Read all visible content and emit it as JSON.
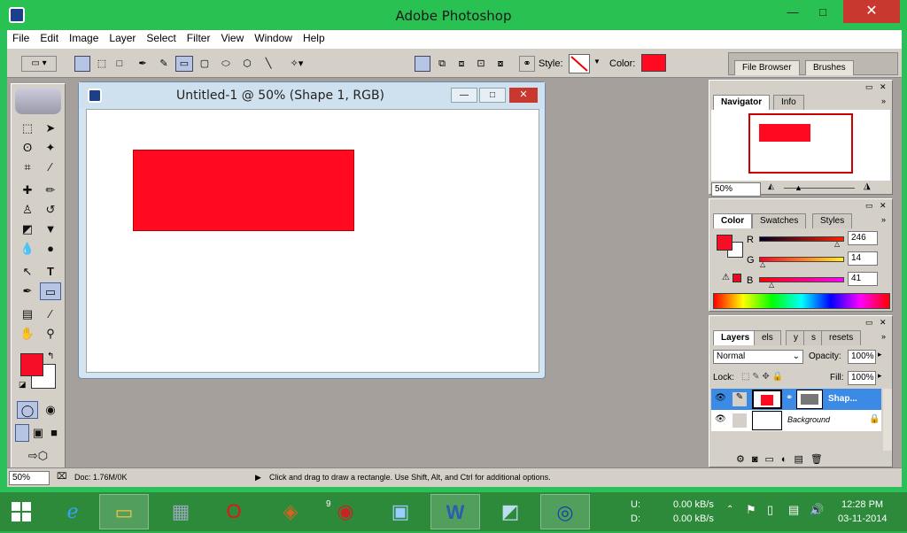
{
  "app_title": "Adobe Photoshop",
  "window_controls": {
    "minimize": "—",
    "maximize": "□",
    "close": "✕"
  },
  "menu": [
    "File",
    "Edit",
    "Image",
    "Layer",
    "Select",
    "Filter",
    "View",
    "Window",
    "Help"
  ],
  "options": {
    "style_label": "Style:",
    "color_label": "Color:",
    "color": "#ff0a20",
    "file_browser": "File Browser",
    "brushes": "Brushes"
  },
  "document": {
    "title": "Untitled-1 @ 50% (Shape 1, RGB)"
  },
  "navigator": {
    "tabs": [
      "Navigator",
      "Info"
    ],
    "zoom": "50%"
  },
  "color_panel": {
    "tabs": [
      "Color",
      "Swatches",
      "Styles"
    ],
    "channels": [
      {
        "label": "R",
        "value": "246",
        "level": 0.965
      },
      {
        "label": "G",
        "value": "14",
        "level": 0.055
      },
      {
        "label": "B",
        "value": "41",
        "level": 0.16
      }
    ],
    "fg": "#f60e29"
  },
  "layers": {
    "tabs": [
      "Layers",
      "els",
      "y",
      "s",
      "resets"
    ],
    "blend": "Normal",
    "opacity_label": "Opacity:",
    "opacity": "100%",
    "lock_label": "Lock:",
    "fill_label": "Fill:",
    "fill": "100%",
    "items": [
      {
        "name": "Shap..."
      },
      {
        "name": "Background"
      }
    ]
  },
  "status": {
    "zoom": "50%",
    "doc": "Doc: 1.76M/0K",
    "hint": "Click and drag to draw a rectangle. Use Shift, Alt, and Ctrl for additional options."
  },
  "taskbar": {
    "badge": "9",
    "net_up_label": "U:",
    "net_up": "0.00 kB/s",
    "net_down_label": "D:",
    "net_down": "0.00 kB/s",
    "time": "12:28 PM",
    "date": "03-11-2014"
  }
}
